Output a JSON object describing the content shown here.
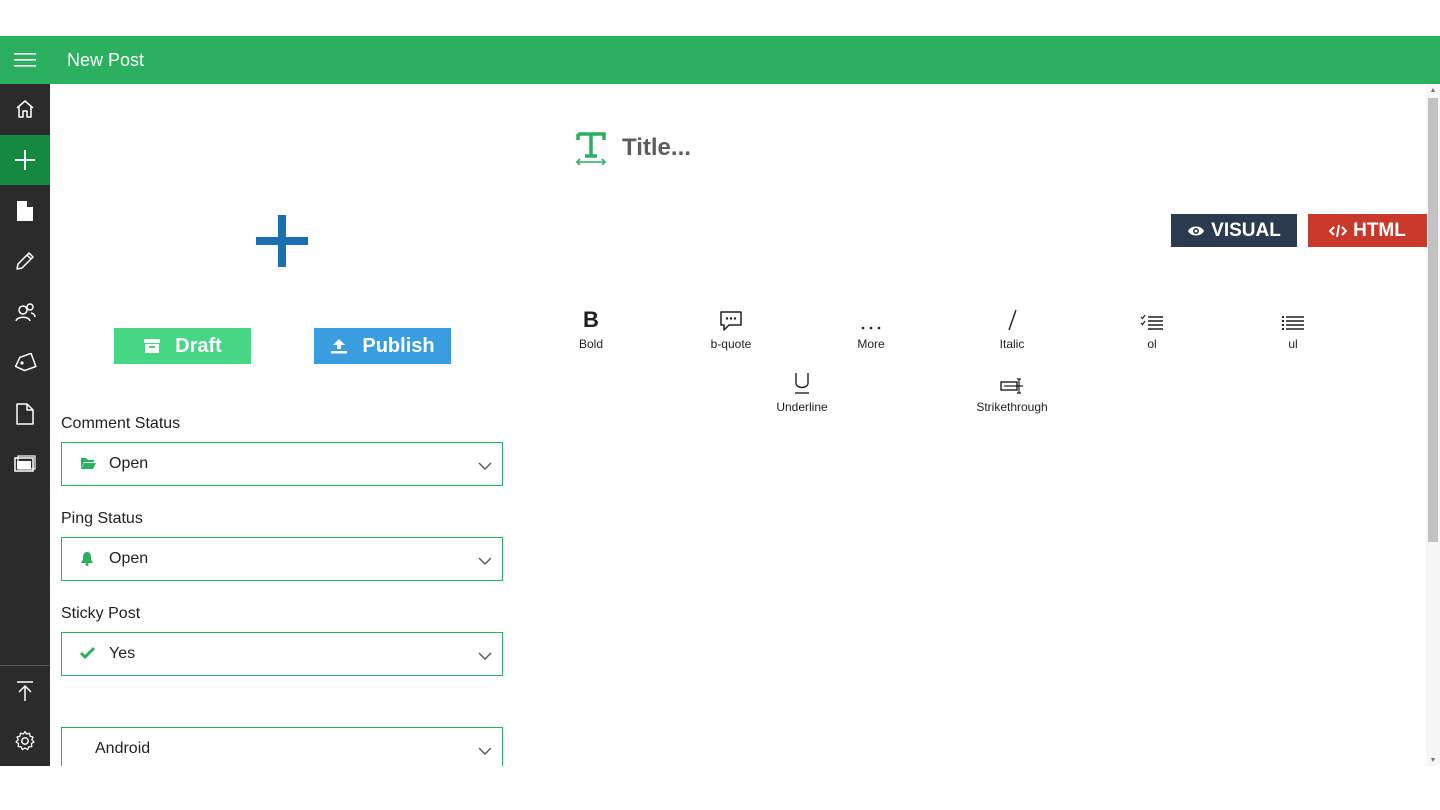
{
  "header": {
    "title": "New Post",
    "menu_icon": "hamburger-menu-icon"
  },
  "sidebar": {
    "items": [
      {
        "name": "home",
        "icon": "home-icon"
      },
      {
        "name": "new-post",
        "icon": "plus-icon",
        "active": true
      },
      {
        "name": "posts",
        "icon": "document-icon"
      },
      {
        "name": "edit",
        "icon": "pencil-icon"
      },
      {
        "name": "users",
        "icon": "users-icon"
      },
      {
        "name": "tags",
        "icon": "tag-icon"
      },
      {
        "name": "pages",
        "icon": "page-icon"
      },
      {
        "name": "media",
        "icon": "media-icon"
      }
    ],
    "bottom": [
      {
        "name": "scroll-top",
        "icon": "upload-arrow-icon"
      },
      {
        "name": "settings",
        "icon": "gear-icon"
      }
    ]
  },
  "editor": {
    "title_placeholder": "Title...",
    "title_value": "",
    "featured_image_icon": "add-image-plus-icon",
    "mode_buttons": {
      "visual": "VISUAL",
      "html": "HTML"
    }
  },
  "actions": {
    "draft": "Draft",
    "publish": "Publish"
  },
  "fields": {
    "comment_status": {
      "label": "Comment Status",
      "value": "Open",
      "icon": "folder-open-icon"
    },
    "ping_status": {
      "label": "Ping Status",
      "value": "Open",
      "icon": "bell-icon"
    },
    "sticky_post": {
      "label": "Sticky Post",
      "value": "Yes",
      "icon": "check-icon"
    },
    "format": {
      "label": "",
      "value": "Android"
    }
  },
  "toolbar": {
    "bold": "Bold",
    "bquote": "b-quote",
    "more": "More",
    "italic": "Italic",
    "ol": "ol",
    "ul": "ul",
    "underline": "Underline",
    "strikethrough": "Strikethrough"
  },
  "colors": {
    "accent": "#2ab05f",
    "sidebar": "#2b2b2b",
    "sidebar_active": "#138a3e",
    "draft": "#47d684",
    "publish": "#3a9de0",
    "visual": "#2b3a4f",
    "html": "#c9392b",
    "add_image": "#1a6fb0"
  }
}
